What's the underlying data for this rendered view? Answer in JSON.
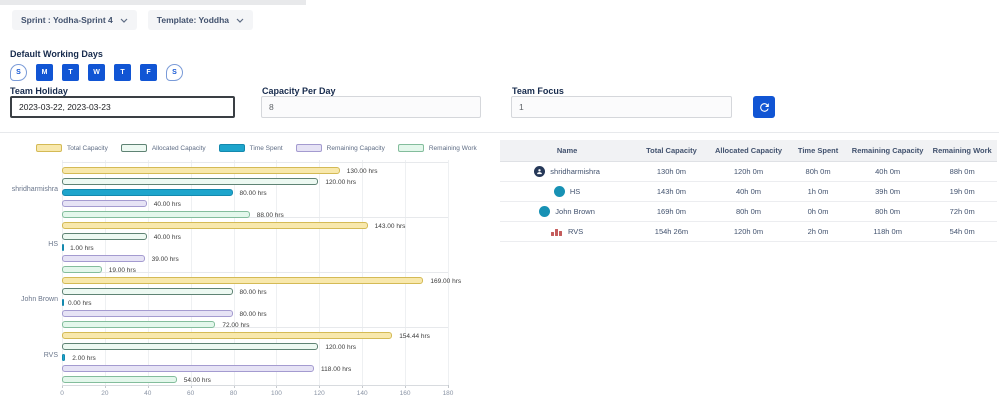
{
  "toolbar": {
    "sprint_label": "Sprint : Yodha-Sprint 4",
    "template_label": "Template: Yoddha"
  },
  "working_days": {
    "title": "Default Working Days",
    "days": [
      {
        "label": "S",
        "selected": false
      },
      {
        "label": "M",
        "selected": true
      },
      {
        "label": "T",
        "selected": true
      },
      {
        "label": "W",
        "selected": true
      },
      {
        "label": "T",
        "selected": true
      },
      {
        "label": "F",
        "selected": true
      },
      {
        "label": "S",
        "selected": false
      }
    ]
  },
  "fields": {
    "team_holiday": {
      "label": "Team Holiday",
      "value": "2023-03-22, 2023-03-23"
    },
    "capacity_per_day": {
      "label": "Capacity Per Day",
      "value": "8"
    },
    "team_focus": {
      "label": "Team Focus",
      "value": "1"
    }
  },
  "accent_blue": "#1155d4",
  "chart_data": {
    "type": "bar",
    "orientation": "horizontal",
    "categories": [
      "shridharmishra",
      "HS",
      "John Brown",
      "RVS"
    ],
    "series": [
      {
        "name": "Total Capacity",
        "fill": "#f8e8ac",
        "border": "#d4ba55",
        "values": [
          130,
          143,
          169,
          154.44
        ]
      },
      {
        "name": "Allocated Capacity",
        "fill": "#edf9f2",
        "border": "#5f8374",
        "values": [
          120,
          40,
          80,
          120
        ]
      },
      {
        "name": "Time Spent",
        "fill": "#1ea5cc",
        "border": "#1489ae",
        "values": [
          80,
          1,
          0,
          2
        ]
      },
      {
        "name": "Remaining Capacity",
        "fill": "#e6e3f5",
        "border": "#a49bd0",
        "values": [
          40,
          39,
          80,
          118
        ]
      },
      {
        "name": "Remaining Work",
        "fill": "#e3f7eb",
        "border": "#83bd9c",
        "values": [
          88,
          19,
          72,
          54
        ]
      }
    ],
    "value_suffix": " hrs",
    "value_decimals": 2,
    "xlim": [
      0,
      180
    ],
    "x_ticks": [
      0,
      20,
      40,
      60,
      80,
      100,
      120,
      140,
      160,
      180
    ],
    "grid": true,
    "legend_position": "top"
  },
  "table": {
    "columns": [
      "Name",
      "Total Capacity",
      "Allocated Capacity",
      "Time Spent",
      "Remaining Capacity",
      "Remaining Work"
    ],
    "rows": [
      {
        "name": "shridharmishra",
        "avatar": "user",
        "avatar_color": "#253858",
        "total": "130h 0m",
        "allocated": "120h 0m",
        "time_spent": "80h 0m",
        "remaining_capacity": "40h 0m",
        "remaining_work": "88h 0m"
      },
      {
        "name": "HS",
        "avatar": "circle",
        "avatar_color": "#1791b4",
        "total": "143h 0m",
        "allocated": "40h 0m",
        "time_spent": "1h 0m",
        "remaining_capacity": "39h 0m",
        "remaining_work": "19h 0m"
      },
      {
        "name": "John Brown",
        "avatar": "circle",
        "avatar_color": "#1791b4",
        "total": "169h 0m",
        "allocated": "80h 0m",
        "time_spent": "0h 0m",
        "remaining_capacity": "80h 0m",
        "remaining_work": "72h 0m"
      },
      {
        "name": "RVS",
        "avatar": "broken",
        "avatar_color": "#c45b5b",
        "total": "154h 26m",
        "allocated": "120h 0m",
        "time_spent": "2h 0m",
        "remaining_capacity": "118h 0m",
        "remaining_work": "54h 0m"
      }
    ]
  }
}
